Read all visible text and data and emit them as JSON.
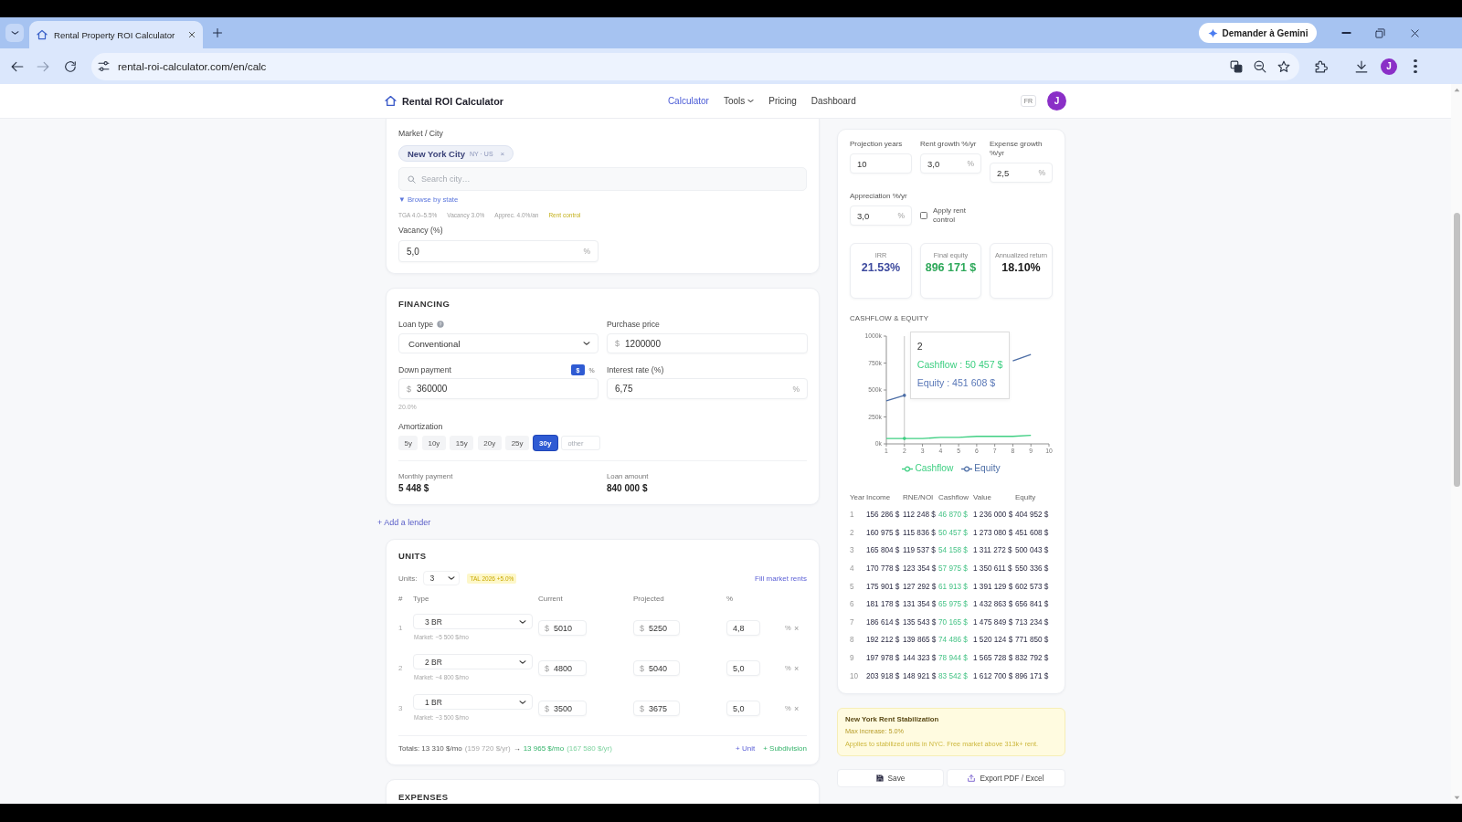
{
  "browser": {
    "tab": {
      "title": "Rental Property ROI Calculator"
    },
    "gemini_button": "Demander à Gemini",
    "url": "rental-roi-calculator.com/en/calc",
    "profile_initial": "J"
  },
  "header": {
    "logo": "Rental ROI Calculator",
    "nav": [
      {
        "label": "Calculator",
        "kind": "link",
        "selected": true
      },
      {
        "label": "Tools",
        "kind": "menu",
        "selected": false
      },
      {
        "label": "Pricing",
        "kind": "link",
        "selected": false
      },
      {
        "label": "Dashboard",
        "kind": "link",
        "selected": false
      }
    ],
    "language": "FR",
    "avatar_initial": "J"
  },
  "market": {
    "label": "Market / City",
    "chip": {
      "city": "New York City",
      "region": "NY · US",
      "remove": "×"
    },
    "search": {
      "placeholder": "Search city…"
    },
    "browse_link": "▼ Browse by state",
    "stats": [
      {
        "text": "TGA 4.0–5.5%",
        "kind": "plain"
      },
      {
        "text": "Vacancy 3.0%",
        "kind": "plain"
      },
      {
        "text": "Apprec. 4.0%/an",
        "kind": "plain"
      },
      {
        "text": "Rent control",
        "kind": "flag"
      }
    ],
    "vacancy": {
      "label": "Vacancy (%)",
      "value": "5,0",
      "unit": "%"
    }
  },
  "financing": {
    "title": "FINANCING",
    "loan_type": {
      "label": "Loan type",
      "value": "Conventional"
    },
    "purchase_price": {
      "label": "Purchase price",
      "prefix": "$",
      "value": "1200000"
    },
    "down_payment": {
      "label": "Down payment",
      "modes": [
        {
          "label": "$",
          "selected": true
        },
        {
          "label": "%",
          "selected": false
        }
      ],
      "prefix": "$",
      "value": "360000",
      "note": "20.0%"
    },
    "interest_rate": {
      "label": "Interest rate (%)",
      "value": "6,75",
      "unit": "%"
    },
    "amortization": {
      "label": "Amortization",
      "options": [
        {
          "label": "5y",
          "selected": false
        },
        {
          "label": "10y",
          "selected": false
        },
        {
          "label": "15y",
          "selected": false
        },
        {
          "label": "20y",
          "selected": false
        },
        {
          "label": "25y",
          "selected": false
        },
        {
          "label": "30y",
          "selected": true
        }
      ],
      "other": {
        "placeholder": "other"
      }
    },
    "summary": [
      {
        "label": "Monthly payment",
        "value": "5 448 $"
      },
      {
        "label": "Loan amount",
        "value": "840 000 $"
      }
    ]
  },
  "add_lender": "+ Add a lender",
  "units": {
    "title": "UNITS",
    "count_label": "Units:",
    "count": "3",
    "badge": "TAL 2026 +5.0%",
    "fill_link": "Fill market rents",
    "columns": [
      "#",
      "Type",
      "Current",
      "Projected",
      "%"
    ],
    "rows": [
      {
        "index": "1",
        "type": "3 BR",
        "market": "Market: ~5 500 $/mo",
        "current": {
          "prefix": "$",
          "value": "5010"
        },
        "projected": {
          "prefix": "$",
          "value": "5250"
        },
        "change": {
          "value": "4,8"
        },
        "unit": "%",
        "remove": "×"
      },
      {
        "index": "2",
        "type": "2 BR",
        "market": "Market: ~4 800 $/mo",
        "current": {
          "prefix": "$",
          "value": "4800"
        },
        "projected": {
          "prefix": "$",
          "value": "5040"
        },
        "change": {
          "value": "5,0"
        },
        "unit": "%",
        "remove": "×"
      },
      {
        "index": "3",
        "type": "1 BR",
        "market": "Market: ~3 500 $/mo",
        "current": {
          "prefix": "$",
          "value": "3500"
        },
        "projected": {
          "prefix": "$",
          "value": "3675"
        },
        "change": {
          "value": "5,0"
        },
        "unit": "%",
        "remove": "×"
      }
    ],
    "totals": {
      "current": "Totals: 13 310 $/mo",
      "current_yearly": "(159 720 $/yr)",
      "arrow": "→",
      "projected": "13 965 $/mo",
      "projected_yearly": "(167 580 $/yr)"
    },
    "actions": [
      {
        "label": "+ Unit",
        "kind": "add"
      },
      {
        "label": "+ Subdivision",
        "kind": "split"
      }
    ]
  },
  "expenses": {
    "title": "EXPENSES"
  },
  "projection": {
    "fields": [
      {
        "label": "Projection years",
        "value": "10"
      },
      {
        "label": "Rent growth %/yr",
        "value": "3,0",
        "unit": "%"
      },
      {
        "label": "Expense growth %/yr",
        "value": "2,5",
        "unit": "%"
      },
      {
        "label": "Appreciation %/yr",
        "value": "3,0",
        "unit": "%"
      }
    ],
    "rent_control": {
      "label": "Apply rent control",
      "checked": false
    }
  },
  "metrics": [
    {
      "label": "IRR",
      "value": "21.53%",
      "color": "#3d4a9e"
    },
    {
      "label": "Final equity",
      "value": "896 171 $",
      "color": "#2ea85a"
    },
    {
      "label": "Annualized return",
      "value": "18.10%",
      "color": "#1a1a1a"
    }
  ],
  "chart": {
    "title": "CASHFLOW & EQUITY",
    "chart_data": {
      "type": "line",
      "x": [
        1,
        2,
        3,
        4,
        5,
        6,
        7,
        8,
        9
      ],
      "series": [
        {
          "name": "Cashflow",
          "color": "#3ecf82",
          "values": [
            50000,
            50000,
            50000,
            60000,
            60000,
            70000,
            70000,
            70000,
            80000
          ]
        },
        {
          "name": "Equity",
          "color": "#4d6ea6",
          "values": [
            400000,
            450000,
            null,
            null,
            null,
            null,
            null,
            770000,
            830000
          ]
        }
      ],
      "xlim": [
        1,
        10
      ],
      "ylim": [
        0,
        1000000
      ],
      "xticks": [
        1,
        2,
        3,
        4,
        5,
        6,
        7,
        8,
        9,
        10
      ],
      "yticks": [
        {
          "value": 0,
          "label": "0k"
        },
        {
          "value": 250000,
          "label": "250k"
        },
        {
          "value": 500000,
          "label": "500k"
        },
        {
          "value": 750000,
          "label": "750k"
        },
        {
          "value": 1000000,
          "label": "1000k"
        }
      ],
      "ref_lines": [
        {
          "axis": "x",
          "value": 2
        }
      ],
      "annotations": [
        "2"
      ]
    },
    "tooltip": {
      "lines": [
        {
          "text": "Cashflow : 50 457 $",
          "color": "#3ecf82"
        },
        {
          "text": "Equity : 451 608 $",
          "color": "#5a78b8"
        }
      ]
    }
  },
  "table": {
    "columns": [
      {
        "label": "Year",
        "kind": "index"
      },
      {
        "label": "Income",
        "kind": "amount"
      },
      {
        "label": "RNE/NOI",
        "kind": "amount"
      },
      {
        "label": "Cashflow",
        "kind": "gain"
      },
      {
        "label": "Value",
        "kind": "amount"
      },
      {
        "label": "Equity",
        "kind": "amount"
      }
    ],
    "rows": [
      [
        "1",
        "156 286 $",
        "112 248 $",
        "46 870 $",
        "1 236 000 $",
        "404 952 $"
      ],
      [
        "2",
        "160 975 $",
        "115 836 $",
        "50 457 $",
        "1 273 080 $",
        "451 608 $"
      ],
      [
        "3",
        "165 804 $",
        "119 537 $",
        "54 158 $",
        "1 311 272 $",
        "500 043 $"
      ],
      [
        "4",
        "170 778 $",
        "123 354 $",
        "57 975 $",
        "1 350 611 $",
        "550 336 $"
      ],
      [
        "5",
        "175 901 $",
        "127 292 $",
        "61 913 $",
        "1 391 129 $",
        "602 573 $"
      ],
      [
        "6",
        "181 178 $",
        "131 354 $",
        "65 975 $",
        "1 432 863 $",
        "656 841 $"
      ],
      [
        "7",
        "186 614 $",
        "135 543 $",
        "70 165 $",
        "1 475 849 $",
        "713 234 $"
      ],
      [
        "8",
        "192 212 $",
        "139 865 $",
        "74 486 $",
        "1 520 124 $",
        "771 850 $"
      ],
      [
        "9",
        "197 978 $",
        "144 323 $",
        "78 944 $",
        "1 565 728 $",
        "832 792 $"
      ],
      [
        "10",
        "203 918 $",
        "148 921 $",
        "83 542 $",
        "1 612 700 $",
        "896 171 $"
      ]
    ]
  },
  "notice": {
    "title": "New York Rent Stabilization",
    "limit": "Max increase: 5.0%",
    "text": "Applies to stabilized units in NYC. Free market above 313k+ rent."
  },
  "buttons": [
    {
      "label": "Save",
      "kind": "save"
    },
    {
      "label": "Export PDF / Excel",
      "kind": "export"
    }
  ]
}
